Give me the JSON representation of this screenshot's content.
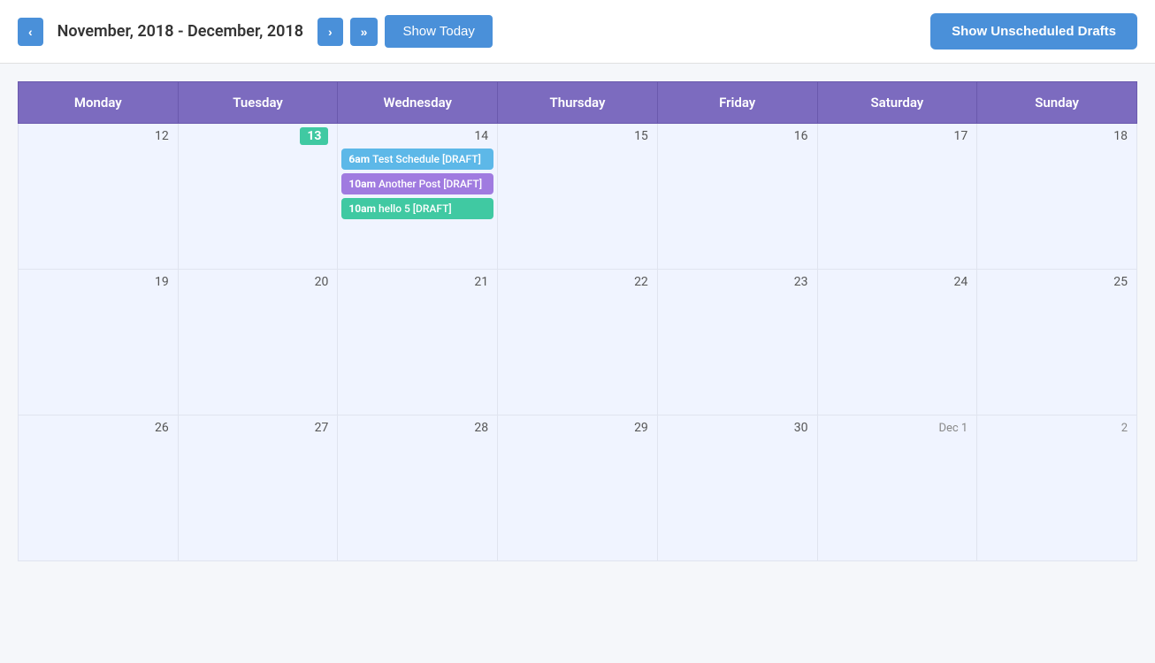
{
  "header": {
    "date_range": "November, 2018 - December, 2018",
    "prev_label": "‹",
    "next_label": "›",
    "next_next_label": "»",
    "show_today_label": "Show Today",
    "show_drafts_label": "Show Unscheduled Drafts"
  },
  "calendar": {
    "days_of_week": [
      "Monday",
      "Tuesday",
      "Wednesday",
      "Thursday",
      "Friday",
      "Saturday",
      "Sunday"
    ],
    "weeks": [
      {
        "dates": [
          "12",
          "13",
          "14",
          "15",
          "16",
          "17",
          "18"
        ],
        "today_index": 1,
        "events": {
          "2": [
            {
              "time": "6am",
              "title": "Test Schedule [DRAFT]",
              "color": "blue"
            },
            {
              "time": "10am",
              "title": "Another Post [DRAFT]",
              "color": "purple"
            },
            {
              "time": "10am",
              "title": "hello 5 [DRAFT]",
              "color": "teal"
            }
          ]
        }
      },
      {
        "dates": [
          "19",
          "20",
          "21",
          "22",
          "23",
          "24",
          "25"
        ],
        "today_index": -1,
        "events": {}
      },
      {
        "dates": [
          "26",
          "27",
          "28",
          "29",
          "30",
          "Dec 1",
          "2"
        ],
        "today_index": -1,
        "events": {}
      }
    ]
  }
}
